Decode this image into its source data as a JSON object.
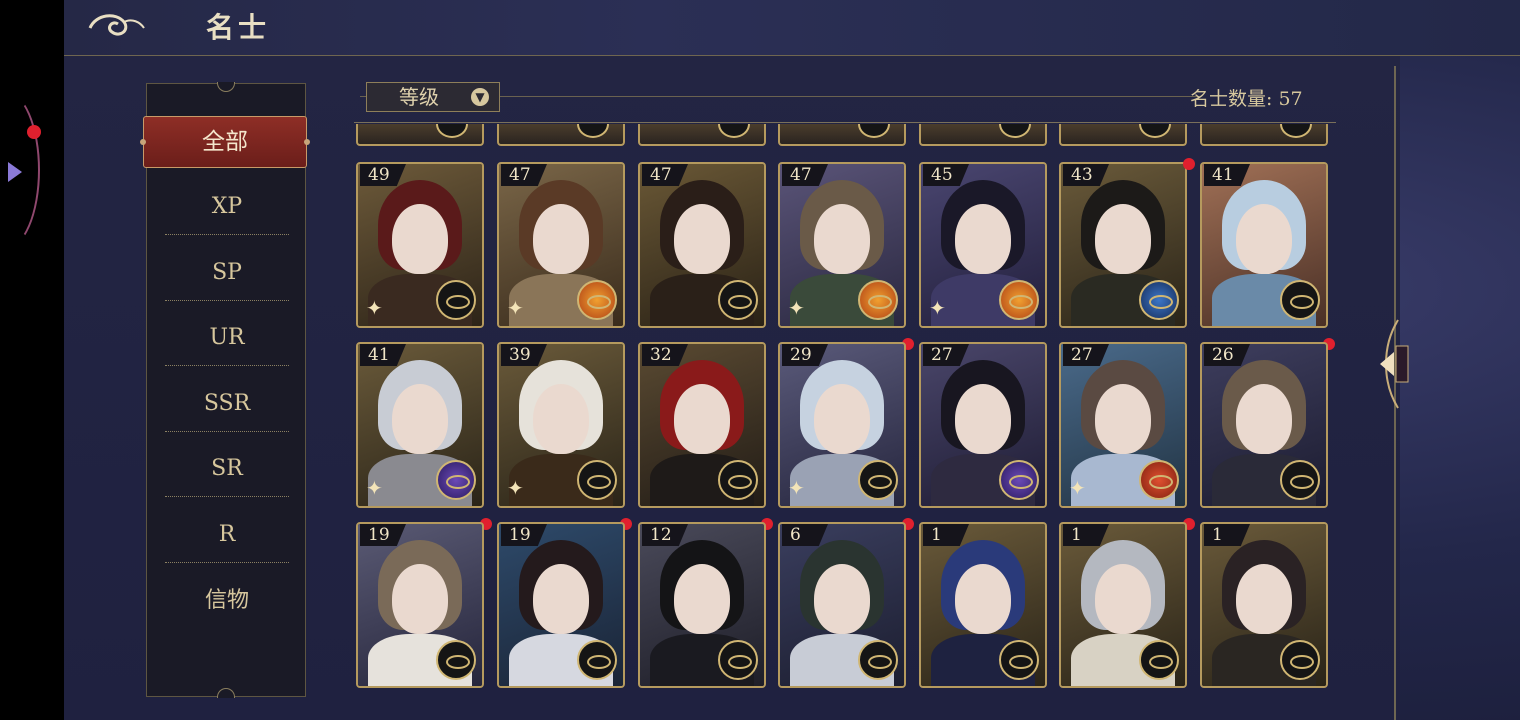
{
  "header": {
    "title": "名士"
  },
  "categories": {
    "items": [
      "全部",
      "XP",
      "SP",
      "UR",
      "SSR",
      "SR",
      "R",
      "信物"
    ],
    "active": "全部"
  },
  "filter": {
    "sort_label": "等级",
    "count_label": "名士数量: 57"
  },
  "colors": {
    "accent_red": "#e0202e",
    "gold": "#b59a5e",
    "active_tab": "#8e2e26"
  },
  "cards": [
    {
      "level": "49",
      "badge": "compass"
    },
    {
      "level": "47",
      "badge": "orange"
    },
    {
      "level": "47",
      "badge": "compass"
    },
    {
      "level": "47",
      "badge": "orange"
    },
    {
      "level": "45",
      "badge": "orange"
    },
    {
      "level": "43",
      "badge": "blue"
    },
    {
      "level": "41",
      "badge": "compass"
    },
    {
      "level": "41",
      "badge": "purple"
    },
    {
      "level": "39",
      "badge": "compass"
    },
    {
      "level": "32",
      "badge": "compass"
    },
    {
      "level": "29",
      "badge": "compass"
    },
    {
      "level": "27",
      "badge": "purple"
    },
    {
      "level": "27",
      "badge": "red"
    },
    {
      "level": "26",
      "badge": "compass"
    },
    {
      "level": "19",
      "badge": "compass"
    },
    {
      "level": "19",
      "badge": "compass"
    },
    {
      "level": "12",
      "badge": "compass"
    },
    {
      "level": "6",
      "badge": "compass"
    },
    {
      "level": "1",
      "badge": "compass"
    },
    {
      "level": "1",
      "badge": "compass"
    },
    {
      "level": "1",
      "badge": "compass"
    }
  ]
}
